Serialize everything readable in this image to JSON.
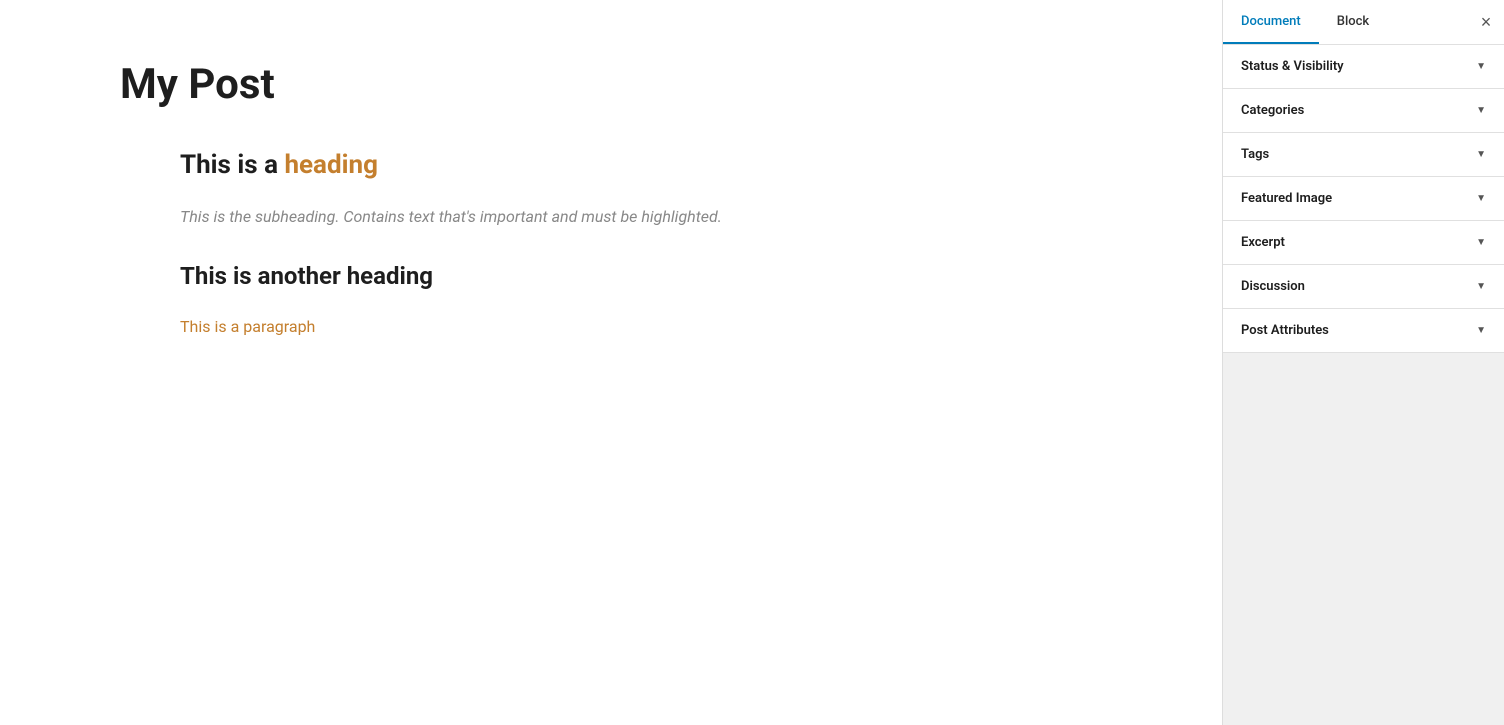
{
  "main": {
    "post_title": "My Post",
    "content": {
      "heading1_prefix": "This is a ",
      "heading1_highlight": "heading",
      "subheading": "This is the subheading. Contains text that's important and must be highlighted.",
      "heading2": "This is another heading",
      "paragraph": "This is a paragraph"
    }
  },
  "sidebar": {
    "tab_document": "Document",
    "tab_block": "Block",
    "close_label": "×",
    "panels": [
      {
        "label": "Status & Visibility"
      },
      {
        "label": "Categories"
      },
      {
        "label": "Tags"
      },
      {
        "label": "Featured Image"
      },
      {
        "label": "Excerpt"
      },
      {
        "label": "Discussion"
      },
      {
        "label": "Post Attributes"
      }
    ]
  },
  "colors": {
    "link_color": "#c47f2e",
    "active_tab_color": "#007cba",
    "heading_color": "#1e1e1e",
    "subheading_color": "#888888"
  }
}
